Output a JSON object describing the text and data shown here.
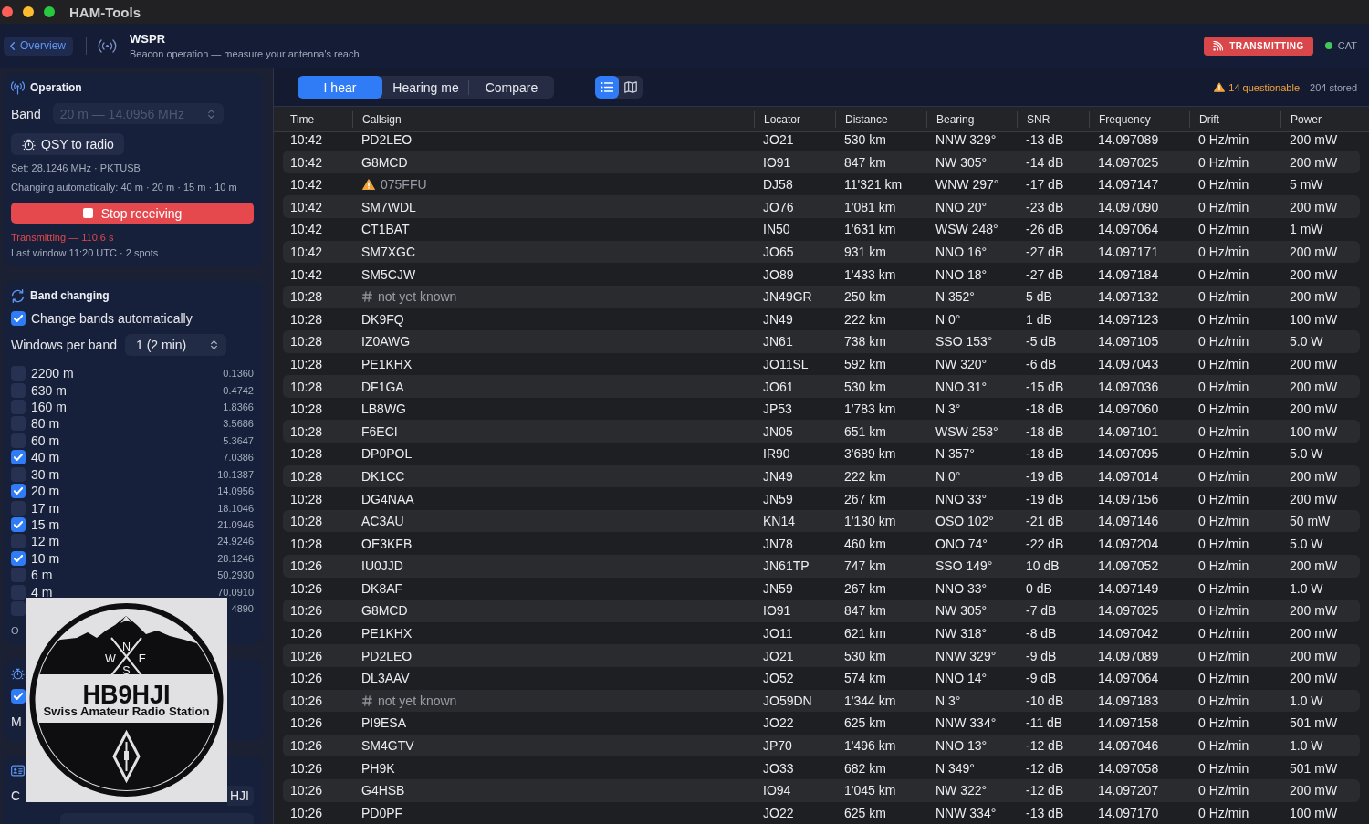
{
  "window": {
    "title": "HAM-Tools"
  },
  "header": {
    "back_button": "Overview",
    "title": "WSPR",
    "subtitle": "Beacon operation — measure your antenna's reach",
    "status": "TRANSMITTING",
    "cat": {
      "label": "CAT",
      "connected": true
    }
  },
  "operation": {
    "title": "Operation",
    "band": {
      "label": "Band",
      "value": "20 m — 14.0956 MHz",
      "disabled": true
    },
    "qsy_button": "QSY to radio",
    "set_info": "Set: 28.1246 MHz · PKTUSB",
    "auto_info": "Changing automatically: 40 m · 20 m · 15 m · 10 m",
    "stop_button": "Stop receiving",
    "tx_status": "Transmitting — 110.6 s",
    "last_window": "Last window 11:20 UTC · 2 spots"
  },
  "band_changing": {
    "title": "Band changing",
    "auto": {
      "label": "Change bands automatically",
      "checked": true
    },
    "windows": {
      "label": "Windows per band",
      "value": "1 (2 min)"
    },
    "bands": [
      {
        "name": "2200 m",
        "frequency": "0.1360",
        "checked": false
      },
      {
        "name": "630 m",
        "frequency": "0.4742",
        "checked": false
      },
      {
        "name": "160 m",
        "frequency": "1.8366",
        "checked": false
      },
      {
        "name": "80 m",
        "frequency": "3.5686",
        "checked": false
      },
      {
        "name": "60 m",
        "frequency": "5.3647",
        "checked": false
      },
      {
        "name": "40 m",
        "frequency": "7.0386",
        "checked": true
      },
      {
        "name": "30 m",
        "frequency": "10.1387",
        "checked": false
      },
      {
        "name": "20 m",
        "frequency": "14.0956",
        "checked": true
      },
      {
        "name": "17 m",
        "frequency": "18.1046",
        "checked": false
      },
      {
        "name": "15 m",
        "frequency": "21.0946",
        "checked": true
      },
      {
        "name": "12 m",
        "frequency": "24.9246",
        "checked": false
      },
      {
        "name": "10 m",
        "frequency": "28.1246",
        "checked": true
      },
      {
        "name": "6 m",
        "frequency": "50.2930",
        "checked": false
      },
      {
        "name": "4 m",
        "frequency": "70.0910",
        "checked": false
      },
      {
        "frequency": "4890",
        "checked": false
      }
    ],
    "note": "O"
  },
  "radio": {
    "set_frequency": {
      "checked": true
    },
    "mode": {
      "label": "M"
    }
  },
  "details": {
    "callsign": {
      "label": "C",
      "value": "HJI"
    }
  },
  "logo": {
    "compass": [
      "N",
      "W",
      "E",
      "S"
    ],
    "callsign": "HB9HJI",
    "motto": "Swiss Amateur Radio Station"
  },
  "toolbar": {
    "tabs": [
      {
        "label": "I hear",
        "selected": true
      },
      {
        "label": "Hearing me",
        "selected": false
      },
      {
        "label": "Compare",
        "selected": false
      }
    ],
    "views": [
      {
        "kind": "list",
        "selected": true
      },
      {
        "kind": "map",
        "selected": false
      }
    ],
    "questionable": "14 questionable",
    "stored": "204 stored"
  },
  "table": {
    "columns": [
      "Time",
      "Callsign",
      "Locator",
      "Distance",
      "Bearing",
      "SNR",
      "Frequency",
      "Drift",
      "Power"
    ],
    "rows": [
      {
        "kind": "normal",
        "time": "10:42",
        "callsign": "PD2LEO",
        "locator": "JO21",
        "distance": "530 km",
        "bearing": "NNW 329°",
        "snr": "-13 dB",
        "frequency": "14.097089",
        "drift": "0 Hz/min",
        "power": "200 mW"
      },
      {
        "kind": "normal",
        "time": "10:42",
        "callsign": "G8MCD",
        "locator": "IO91",
        "distance": "847 km",
        "bearing": "NW 305°",
        "snr": "-14 dB",
        "frequency": "14.097025",
        "drift": "0 Hz/min",
        "power": "200 mW"
      },
      {
        "kind": "questionable",
        "time": "10:42",
        "callsign": "075FFU",
        "locator": "DJ58",
        "distance": "11'321 km",
        "bearing": "WNW 297°",
        "snr": "-17 dB",
        "frequency": "14.097147",
        "drift": "0 Hz/min",
        "power": "5 mW"
      },
      {
        "kind": "normal",
        "time": "10:42",
        "callsign": "SM7WDL",
        "locator": "JO76",
        "distance": "1'081 km",
        "bearing": "NNO 20°",
        "snr": "-23 dB",
        "frequency": "14.097090",
        "drift": "0 Hz/min",
        "power": "200 mW"
      },
      {
        "kind": "normal",
        "time": "10:42",
        "callsign": "CT1BAT",
        "locator": "IN50",
        "distance": "1'631 km",
        "bearing": "WSW 248°",
        "snr": "-26 dB",
        "frequency": "14.097064",
        "drift": "0 Hz/min",
        "power": "1 mW"
      },
      {
        "kind": "normal",
        "time": "10:42",
        "callsign": "SM7XGC",
        "locator": "JO65",
        "distance": "931 km",
        "bearing": "NNO 16°",
        "snr": "-27 dB",
        "frequency": "14.097171",
        "drift": "0 Hz/min",
        "power": "200 mW"
      },
      {
        "kind": "normal",
        "time": "10:42",
        "callsign": "SM5CJW",
        "locator": "JO89",
        "distance": "1'433 km",
        "bearing": "NNO 18°",
        "snr": "-27 dB",
        "frequency": "14.097184",
        "drift": "0 Hz/min",
        "power": "200 mW"
      },
      {
        "kind": "unknown",
        "time": "10:28",
        "callsign": "not yet known",
        "locator": "JN49GR",
        "distance": "250 km",
        "bearing": "N 352°",
        "snr": "5 dB",
        "frequency": "14.097132",
        "drift": "0 Hz/min",
        "power": "200 mW"
      },
      {
        "kind": "normal",
        "time": "10:28",
        "callsign": "DK9FQ",
        "locator": "JN49",
        "distance": "222 km",
        "bearing": "N 0°",
        "snr": "1 dB",
        "frequency": "14.097123",
        "drift": "0 Hz/min",
        "power": "100 mW"
      },
      {
        "kind": "normal",
        "time": "10:28",
        "callsign": "IZ0AWG",
        "locator": "JN61",
        "distance": "738 km",
        "bearing": "SSO 153°",
        "snr": "-5 dB",
        "frequency": "14.097105",
        "drift": "0 Hz/min",
        "power": "5.0 W"
      },
      {
        "kind": "normal",
        "time": "10:28",
        "callsign": "PE1KHX",
        "locator": "JO11SL",
        "distance": "592 km",
        "bearing": "NW 320°",
        "snr": "-6 dB",
        "frequency": "14.097043",
        "drift": "0 Hz/min",
        "power": "200 mW"
      },
      {
        "kind": "normal",
        "time": "10:28",
        "callsign": "DF1GA",
        "locator": "JO61",
        "distance": "530 km",
        "bearing": "NNO 31°",
        "snr": "-15 dB",
        "frequency": "14.097036",
        "drift": "0 Hz/min",
        "power": "200 mW"
      },
      {
        "kind": "normal",
        "time": "10:28",
        "callsign": "LB8WG",
        "locator": "JP53",
        "distance": "1'783 km",
        "bearing": "N 3°",
        "snr": "-18 dB",
        "frequency": "14.097060",
        "drift": "0 Hz/min",
        "power": "200 mW"
      },
      {
        "kind": "normal",
        "time": "10:28",
        "callsign": "F6ECI",
        "locator": "JN05",
        "distance": "651 km",
        "bearing": "WSW 253°",
        "snr": "-18 dB",
        "frequency": "14.097101",
        "drift": "0 Hz/min",
        "power": "100 mW"
      },
      {
        "kind": "normal",
        "time": "10:28",
        "callsign": "DP0POL",
        "locator": "IR90",
        "distance": "3'689 km",
        "bearing": "N 357°",
        "snr": "-18 dB",
        "frequency": "14.097095",
        "drift": "0 Hz/min",
        "power": "5.0 W"
      },
      {
        "kind": "normal",
        "time": "10:28",
        "callsign": "DK1CC",
        "locator": "JN49",
        "distance": "222 km",
        "bearing": "N 0°",
        "snr": "-19 dB",
        "frequency": "14.097014",
        "drift": "0 Hz/min",
        "power": "200 mW"
      },
      {
        "kind": "normal",
        "time": "10:28",
        "callsign": "DG4NAA",
        "locator": "JN59",
        "distance": "267 km",
        "bearing": "NNO 33°",
        "snr": "-19 dB",
        "frequency": "14.097156",
        "drift": "0 Hz/min",
        "power": "200 mW"
      },
      {
        "kind": "normal",
        "time": "10:28",
        "callsign": "AC3AU",
        "locator": "KN14",
        "distance": "1'130 km",
        "bearing": "OSO 102°",
        "snr": "-21 dB",
        "frequency": "14.097146",
        "drift": "0 Hz/min",
        "power": "50 mW"
      },
      {
        "kind": "normal",
        "time": "10:28",
        "callsign": "OE3KFB",
        "locator": "JN78",
        "distance": "460 km",
        "bearing": "ONO 74°",
        "snr": "-22 dB",
        "frequency": "14.097204",
        "drift": "0 Hz/min",
        "power": "5.0 W"
      },
      {
        "kind": "normal",
        "time": "10:26",
        "callsign": "IU0JJD",
        "locator": "JN61TP",
        "distance": "747 km",
        "bearing": "SSO 149°",
        "snr": "10 dB",
        "frequency": "14.097052",
        "drift": "0 Hz/min",
        "power": "200 mW"
      },
      {
        "kind": "normal",
        "time": "10:26",
        "callsign": "DK8AF",
        "locator": "JN59",
        "distance": "267 km",
        "bearing": "NNO 33°",
        "snr": "0 dB",
        "frequency": "14.097149",
        "drift": "0 Hz/min",
        "power": "1.0 W"
      },
      {
        "kind": "normal",
        "time": "10:26",
        "callsign": "G8MCD",
        "locator": "IO91",
        "distance": "847 km",
        "bearing": "NW 305°",
        "snr": "-7 dB",
        "frequency": "14.097025",
        "drift": "0 Hz/min",
        "power": "200 mW"
      },
      {
        "kind": "normal",
        "time": "10:26",
        "callsign": "PE1KHX",
        "locator": "JO11",
        "distance": "621 km",
        "bearing": "NW 318°",
        "snr": "-8 dB",
        "frequency": "14.097042",
        "drift": "0 Hz/min",
        "power": "200 mW"
      },
      {
        "kind": "normal",
        "time": "10:26",
        "callsign": "PD2LEO",
        "locator": "JO21",
        "distance": "530 km",
        "bearing": "NNW 329°",
        "snr": "-9 dB",
        "frequency": "14.097089",
        "drift": "0 Hz/min",
        "power": "200 mW"
      },
      {
        "kind": "normal",
        "time": "10:26",
        "callsign": "DL3AAV",
        "locator": "JO52",
        "distance": "574 km",
        "bearing": "NNO 14°",
        "snr": "-9 dB",
        "frequency": "14.097064",
        "drift": "0 Hz/min",
        "power": "200 mW"
      },
      {
        "kind": "unknown",
        "time": "10:26",
        "callsign": "not yet known",
        "locator": "JO59DN",
        "distance": "1'344 km",
        "bearing": "N 3°",
        "snr": "-10 dB",
        "frequency": "14.097183",
        "drift": "0 Hz/min",
        "power": "1.0 W"
      },
      {
        "kind": "normal",
        "time": "10:26",
        "callsign": "PI9ESA",
        "locator": "JO22",
        "distance": "625 km",
        "bearing": "NNW 334°",
        "snr": "-11 dB",
        "frequency": "14.097158",
        "drift": "0 Hz/min",
        "power": "501 mW"
      },
      {
        "kind": "normal",
        "time": "10:26",
        "callsign": "SM4GTV",
        "locator": "JP70",
        "distance": "1'496 km",
        "bearing": "NNO 13°",
        "snr": "-12 dB",
        "frequency": "14.097046",
        "drift": "0 Hz/min",
        "power": "1.0 W"
      },
      {
        "kind": "normal",
        "time": "10:26",
        "callsign": "PH9K",
        "locator": "JO33",
        "distance": "682 km",
        "bearing": "N 349°",
        "snr": "-12 dB",
        "frequency": "14.097058",
        "drift": "0 Hz/min",
        "power": "501 mW"
      },
      {
        "kind": "normal",
        "time": "10:26",
        "callsign": "G4HSB",
        "locator": "IO94",
        "distance": "1'045 km",
        "bearing": "NW 322°",
        "snr": "-12 dB",
        "frequency": "14.097207",
        "drift": "0 Hz/min",
        "power": "200 mW"
      },
      {
        "kind": "normal",
        "time": "10:26",
        "callsign": "PD0PF",
        "locator": "JO22",
        "distance": "625 km",
        "bearing": "NNW 334°",
        "snr": "-13 dB",
        "frequency": "14.097170",
        "drift": "0 Hz/min",
        "power": "100 mW"
      }
    ]
  }
}
